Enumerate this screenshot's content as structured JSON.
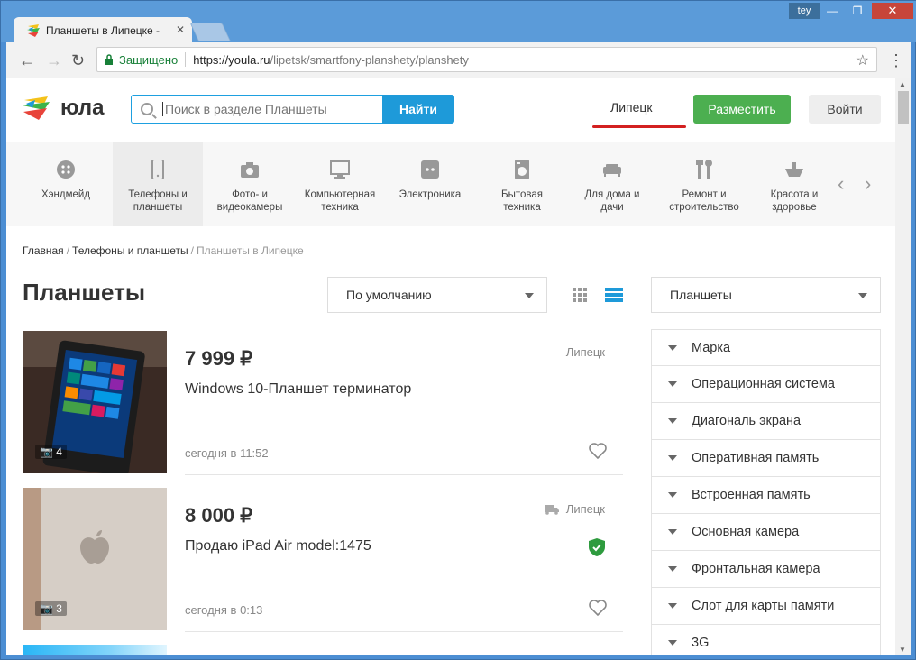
{
  "browser": {
    "tab_title": "Планшеты в Липецке -  ",
    "user": "tey",
    "secure_label": "Защищено",
    "url_host": "https://youla.ru",
    "url_path": "/lipetsk/smartfony-planshety/planshety"
  },
  "header": {
    "logo_text": "юла",
    "search_placeholder": "Поиск в разделе Планшеты",
    "search_button": "Найти",
    "city": "Липецк",
    "post_button": "Разместить",
    "login_button": "Войти"
  },
  "categories": [
    {
      "l1": "Хэндмейд",
      "l2": ""
    },
    {
      "l1": "Телефоны и",
      "l2": "планшеты"
    },
    {
      "l1": "Фото- и",
      "l2": "видеокамеры"
    },
    {
      "l1": "Компьютерная",
      "l2": "техника"
    },
    {
      "l1": "Электроника",
      "l2": ""
    },
    {
      "l1": "Бытовая",
      "l2": "техника"
    },
    {
      "l1": "Для дома и",
      "l2": "дачи"
    },
    {
      "l1": "Ремонт и",
      "l2": "строительство"
    },
    {
      "l1": "Красота и",
      "l2": "здоровье"
    }
  ],
  "breadcrumb": {
    "home": "Главная",
    "section": "Телефоны и планшеты",
    "current": "Планшеты в Липецке"
  },
  "page_title": "Планшеты",
  "sort_value": "По умолчанию",
  "category_select": "Планшеты",
  "listings": [
    {
      "price": "7 999 ₽",
      "title": "Windows 10-Планшет терминатор",
      "city": "Липецк",
      "date": "сегодня в 11:52",
      "photos": "4"
    },
    {
      "price": "8 000 ₽",
      "title": "Продаю iPad Air model:1475",
      "city": "Липецк",
      "date": "сегодня в 0:13",
      "photos": "3"
    }
  ],
  "filters": [
    "Марка",
    "Операционная система",
    "Диагональ экрана",
    "Оперативная память",
    "Встроенная память",
    "Основная камера",
    "Фронтальная камера",
    "Слот для карты памяти",
    "3G"
  ],
  "colors": {
    "accent": "#1e9ad9",
    "post": "#4caf50",
    "underline": "#d32020"
  }
}
